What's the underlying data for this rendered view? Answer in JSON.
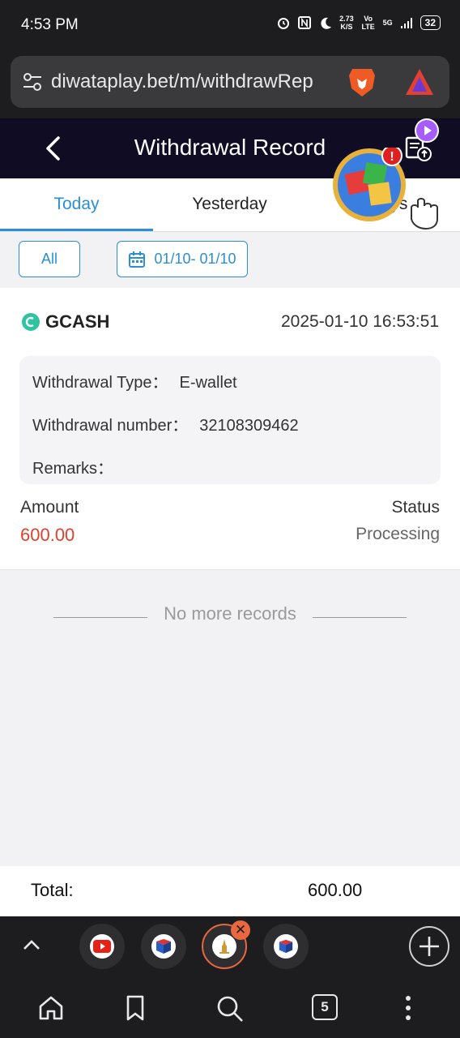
{
  "status_bar": {
    "time": "4:53 PM",
    "net_speed": "2.73",
    "net_unit": "K/S",
    "volte": "Vo LTE",
    "network": "5G",
    "battery": "32"
  },
  "browser": {
    "url": "diwataplay.bet/m/withdrawRep",
    "open_tab_count": "5"
  },
  "header": {
    "title": "Withdrawal Record"
  },
  "tabs": [
    {
      "label": "Today",
      "active": true
    },
    {
      "label": "Yesterday",
      "active": false
    },
    {
      "label": "7 days",
      "active": false
    }
  ],
  "filters": {
    "all_label": "All",
    "date_range": "01/10- 01/10"
  },
  "record": {
    "method": "GCASH",
    "datetime": "2025-01-10 16:53:51",
    "type_label": "Withdrawal Type：",
    "type_value": "E-wallet",
    "number_label": "Withdrawal number：",
    "number_value": "32108309462",
    "remarks_label": "Remarks：",
    "remarks_value": "",
    "amount_label": "Amount",
    "amount_value": "600.00",
    "status_label": "Status",
    "status_value": "Processing"
  },
  "no_more": "No more records",
  "total": {
    "label": "Total:",
    "value": "600.00"
  },
  "colors": {
    "accent": "#2a8fd6",
    "header_bg": "#0f0c24",
    "amount": "#e2402a"
  }
}
